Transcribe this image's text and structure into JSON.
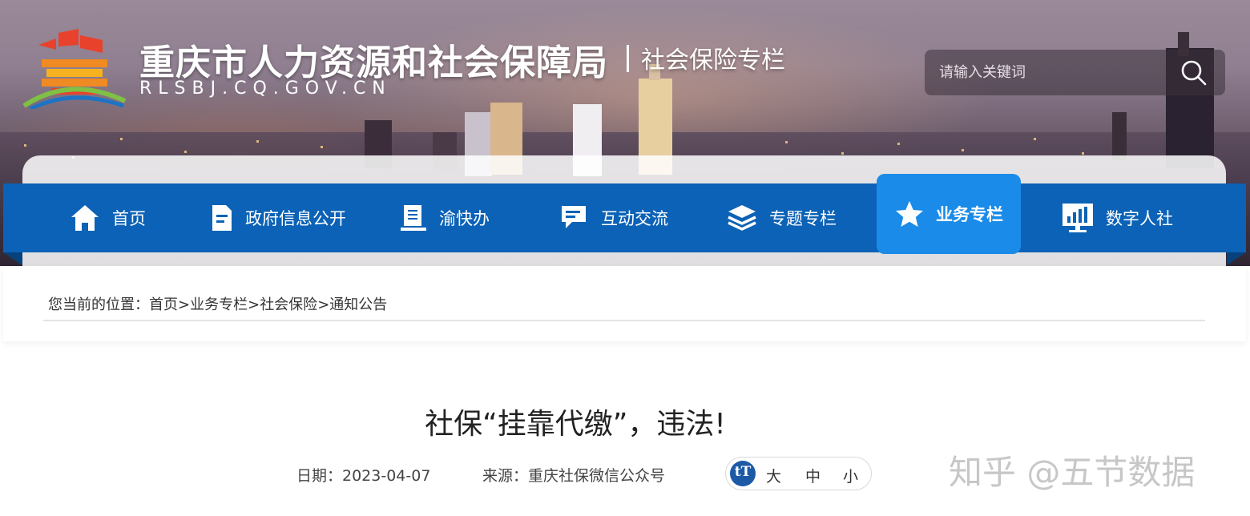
{
  "header": {
    "site_title": "重庆市人力资源和社会保障局",
    "site_subtitle": "社会保险专栏",
    "site_domain": "RLSBJ.CQ.GOV.CN"
  },
  "search": {
    "placeholder": "请输入关键词"
  },
  "nav": {
    "items": [
      {
        "label": "首页",
        "icon": "home-icon"
      },
      {
        "label": "政府信息公开",
        "icon": "document-icon"
      },
      {
        "label": "渝快办",
        "icon": "form-icon"
      },
      {
        "label": "互动交流",
        "icon": "chat-icon"
      },
      {
        "label": "专题专栏",
        "icon": "layers-icon"
      },
      {
        "label": "业务专栏",
        "icon": "star-icon",
        "active": true
      },
      {
        "label": "数字人社",
        "icon": "monitor-chart-icon"
      }
    ]
  },
  "breadcrumb": {
    "prefix": "您当前的位置：",
    "items": [
      "首页",
      "业务专栏",
      "社会保险",
      "通知公告"
    ],
    "separator": ">"
  },
  "article": {
    "title": "社保“挂靠代缴”，违法!",
    "date": "日期：2023-04-07",
    "source": "来源：重庆社保微信公众号",
    "font_icon": "tT",
    "font_sizes": [
      "大",
      "中",
      "小"
    ]
  },
  "watermark": "知乎 @五节数据",
  "colors": {
    "nav_bg": "#0b62b6",
    "nav_active": "#1a8be8"
  }
}
